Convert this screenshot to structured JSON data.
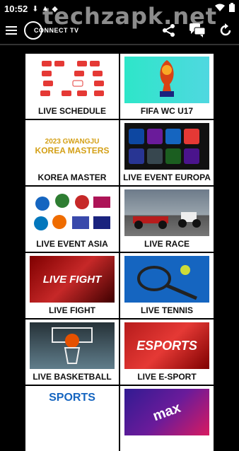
{
  "status": {
    "time": "10:52"
  },
  "watermark": "techzapk.net",
  "app": {
    "logo_text": "CONNECT TV"
  },
  "cards": [
    {
      "label": "LIVE SCHEDULE"
    },
    {
      "label": "FIFA WC U17"
    },
    {
      "label": "KOREA MASTER",
      "thumb_text_1": "2023 GWANGJU",
      "thumb_text_2": "KOREA MASTERS"
    },
    {
      "label": "LIVE EVENT EUROPA"
    },
    {
      "label": "LIVE EVENT ASIA"
    },
    {
      "label": "LIVE RACE"
    },
    {
      "label": "LIVE FIGHT",
      "thumb_text": "LIVE FIGHT"
    },
    {
      "label": "LIVE TENNIS"
    },
    {
      "label": "LIVE BASKETBALL"
    },
    {
      "label": "LIVE E-SPORT",
      "thumb_text": "ESPORTS"
    },
    {
      "thumb_text": "SPORTS"
    },
    {
      "thumb_text": "max"
    }
  ],
  "colors": {
    "accent": "#ffffff",
    "background": "#000000",
    "card": "#ffffff"
  }
}
